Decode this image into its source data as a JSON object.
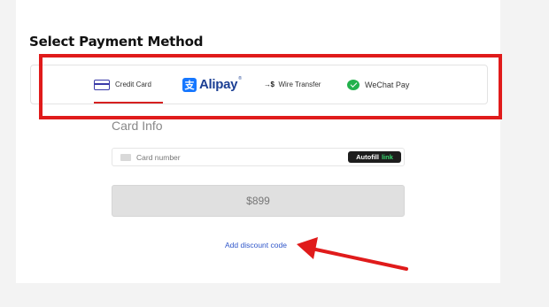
{
  "section": {
    "title": "Select Payment Method"
  },
  "methods": [
    {
      "label": "Credit Card",
      "icon": "credit-card-icon",
      "selected": true
    },
    {
      "label": "Alipay",
      "icon": "alipay-icon",
      "trademark": "®"
    },
    {
      "label": "Wire Transfer",
      "icon": "wire-transfer-icon",
      "glyph": "→$"
    },
    {
      "label": "WeChat Pay",
      "icon": "wechat-pay-icon"
    }
  ],
  "card_info": {
    "title": "Card Info",
    "number_placeholder": "Card number",
    "autofill": {
      "word": "Autofill",
      "link": "link"
    }
  },
  "pay_button": {
    "label": "$899"
  },
  "discount_link": "Add discount code",
  "colors": {
    "highlight": "#e01b1b",
    "selected_underline": "#d62020",
    "link": "#2f56c9",
    "link_brand": "#38d76e"
  }
}
